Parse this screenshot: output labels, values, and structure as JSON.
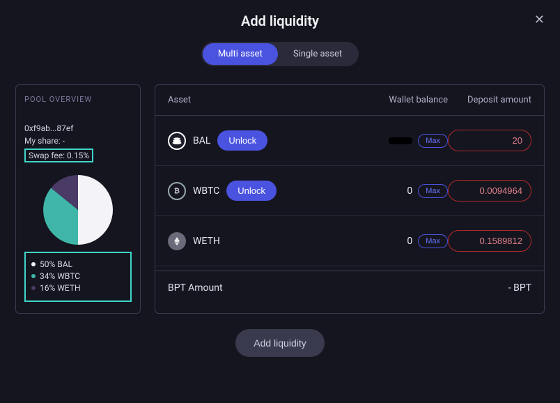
{
  "modal": {
    "title": "Add liquidity",
    "close_aria": "Close"
  },
  "tabs": {
    "multi": "Multi asset",
    "single": "Single asset"
  },
  "sidebar": {
    "heading": "POOL OVERVIEW",
    "pool_address": "0xf9ab...87ef",
    "my_share_label": "My share: -",
    "swap_fee_label": "Swap fee: 0.15%"
  },
  "chart_data": {
    "type": "pie",
    "categories": [
      "BAL",
      "WBTC",
      "WETH"
    ],
    "values": [
      50,
      34,
      16
    ],
    "colors": [
      "#f4f4f8",
      "#3fb6a8",
      "#4a3a66"
    ],
    "legend": [
      "50% BAL",
      "34% WBTC",
      "16% WETH"
    ]
  },
  "table": {
    "headers": {
      "asset": "Asset",
      "wallet": "Wallet balance",
      "deposit": "Deposit amount"
    },
    "unlock_label": "Unlock",
    "max_label": "Max",
    "assets": [
      {
        "symbol": "BAL",
        "needs_unlock": true,
        "wallet_balance": "",
        "wallet_redacted": true,
        "deposit": "20"
      },
      {
        "symbol": "WBTC",
        "needs_unlock": true,
        "wallet_balance": "0",
        "wallet_redacted": false,
        "deposit": "0.0094964"
      },
      {
        "symbol": "WETH",
        "needs_unlock": false,
        "wallet_balance": "0",
        "wallet_redacted": false,
        "deposit": "0.1589812"
      }
    ]
  },
  "bpt": {
    "label": "BPT Amount",
    "value": "- BPT"
  },
  "footer": {
    "add_button": "Add liquidity"
  }
}
